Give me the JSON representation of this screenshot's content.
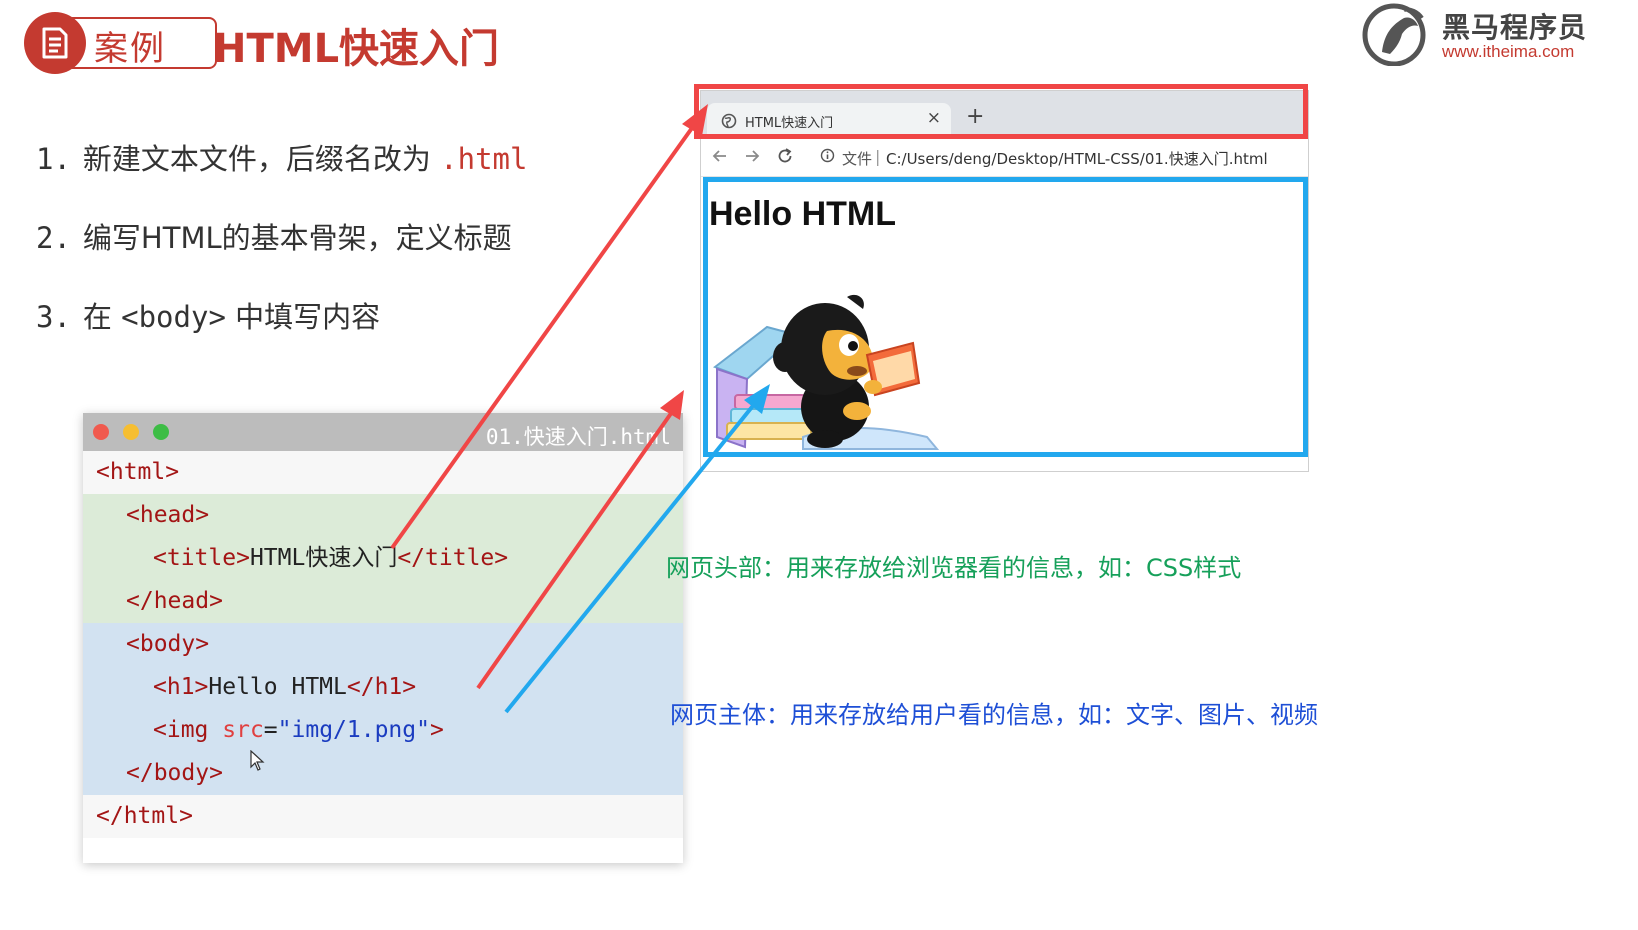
{
  "header": {
    "badge_label": "案例",
    "title": "HTML快速入门",
    "icon": "document-icon"
  },
  "logo": {
    "name": "黑马程序员",
    "url": "www.itheima.com"
  },
  "steps": [
    {
      "num": "1.",
      "text": "新建文本文件，后缀名改为 ",
      "highlight": ".html"
    },
    {
      "num": "2.",
      "text": "编写HTML的基本骨架，定义标题"
    },
    {
      "num": "3.",
      "prefix": "在 ",
      "code": "<body>",
      "suffix": " 中填写内容"
    }
  ],
  "editor": {
    "filename": "01.快速入门.html",
    "lines": {
      "html_open": "<html>",
      "head_open": "<head>",
      "title_open": "<title>",
      "title_text": "HTML快速入门",
      "title_close": "</title>",
      "head_close": "</head>",
      "body_open": "<body>",
      "h1_open": "<h1>",
      "h1_text": "Hello HTML",
      "h1_close": "</h1>",
      "img_open": "<img ",
      "img_attr": "src",
      "img_eq": "=",
      "img_val": "\"img/1.png\"",
      "img_close": ">",
      "body_close": "</body>",
      "html_close": "</html>"
    }
  },
  "browser": {
    "tab_title": "HTML快速入门",
    "tab_close": "×",
    "new_tab": "+",
    "address_label": "文件",
    "address_url": "C:/Users/deng/Desktop/HTML-CSS/01.快速入门.html",
    "page_heading": "Hello HTML"
  },
  "captions": {
    "head": "网页头部：用来存放给浏览器看的信息，如：CSS样式",
    "body": "网页主体：用来存放给用户看的信息，如：文字、图片、视频"
  },
  "colors": {
    "brand_red": "#c43a30",
    "head_bg": "#dcebd8",
    "body_bg": "#d2e2f1",
    "arrow_red": "#f04646",
    "arrow_blue": "#22a8ee",
    "caption_green": "#16a05a",
    "caption_blue": "#1e4fd6"
  }
}
